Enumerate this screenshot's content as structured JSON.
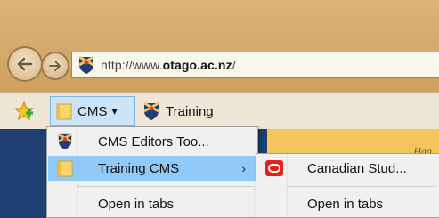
{
  "browser": {
    "url_prefix": "http://www.",
    "url_domain": "otago.ac.nz",
    "url_suffix": "/"
  },
  "favorites_bar": {
    "cms_label": "CMS",
    "cms_caret": "▾",
    "training_label": "Training"
  },
  "page": {
    "italic_text": "Haa"
  },
  "menu_main": {
    "items": [
      {
        "label": "CMS Editors Too..."
      },
      {
        "label": "Training CMS",
        "arrow": "›"
      },
      {
        "label": "Open in tabs"
      }
    ]
  },
  "menu_sub": {
    "items": [
      {
        "label": "Canadian Stud..."
      },
      {
        "label": "Open in tabs"
      }
    ]
  },
  "colors": {
    "highlight": "#91c9f7",
    "page_blue": "#1f3e72",
    "page_gold": "#f2c65a"
  }
}
